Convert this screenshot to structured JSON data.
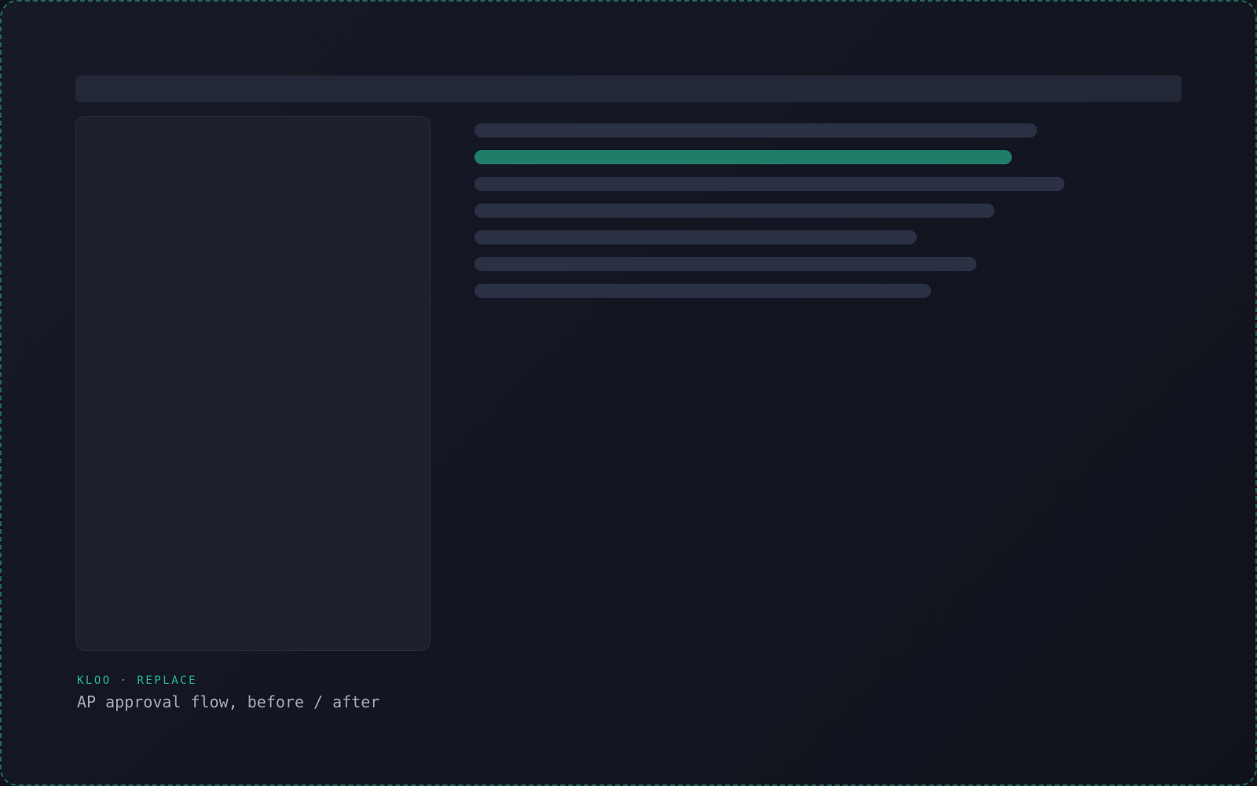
{
  "caption": {
    "eyebrow": "KLOO · REPLACE",
    "title": "AP approval flow, before / after"
  },
  "rows": [
    {
      "fill": 0.795
    },
    {
      "fill": 0.76,
      "highlighted": true
    },
    {
      "fill": 0.834
    },
    {
      "fill": 0.735
    },
    {
      "fill": 0.626
    },
    {
      "fill": 0.71
    },
    {
      "fill": 0.645
    }
  ],
  "colors": {
    "accent": "#1f7e67",
    "accent_text": "#29b896",
    "placeholder": "#2b3144",
    "panel": "#1c202d",
    "background": "#131622",
    "frame_border": "#1f6b57"
  }
}
